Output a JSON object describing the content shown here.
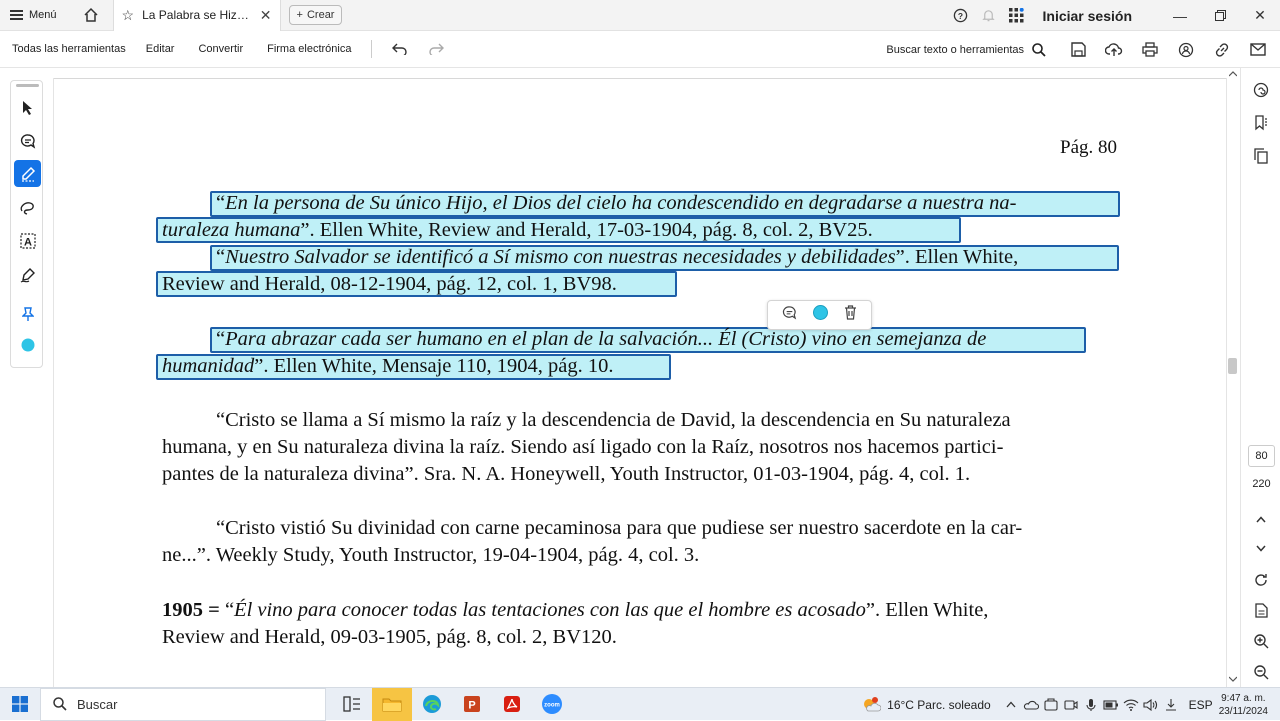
{
  "titlebar": {
    "menu_label": "Menú",
    "tab_title": "La Palabra se Hizo C...",
    "create_label": "Crear",
    "signin_label": "Iniciar sesión"
  },
  "toolbar": {
    "all_tools": "Todas las herramientas",
    "edit": "Editar",
    "convert": "Convertir",
    "esign": "Firma electrónica",
    "search_label": "Buscar texto o herramientas"
  },
  "document": {
    "page_label": "Pág. 80",
    "lines": [
      {
        "pre": "“",
        "it": "En la persona de Su único Hijo, el Dios del cielo ha condescendido en degradarse a nuestra na-",
        "post": ""
      },
      {
        "pre": "",
        "it": "turaleza humana",
        "post": "”. Ellen White, Review and Herald, 17-03-1904, pág. 8, col. 2, BV25."
      },
      {
        "pre": "“",
        "it": "Nuestro Salvador se identificó a Sí mismo con nuestras necesidades y debilidades",
        "post": "”. Ellen White,"
      },
      {
        "pre": "",
        "it": "",
        "post": "Review and Herald, 08-12-1904, pág. 12, col. 1, BV98."
      },
      {
        "pre": "“",
        "it": "Para abrazar cada ser humano en el plan de la salvación... Él (Cristo) vino en semejanza de",
        "post": ""
      },
      {
        "pre": "",
        "it": "humanidad",
        "post": "”. Ellen White, Mensaje 110, 1904, pág. 10."
      },
      {
        "pre": "",
        "it": "",
        "post": "“Cristo se llama a Sí mismo la raíz y la descendencia de David, la descendencia en Su naturaleza"
      },
      {
        "pre": "",
        "it": "",
        "post": "humana, y en Su naturaleza divina la raíz. Siendo así ligado con la Raíz, nosotros nos hacemos partici-"
      },
      {
        "pre": "",
        "it": "",
        "post": "pantes de la naturaleza divina”. Sra. N. A. Honeywell, Youth Instructor, 01-03-1904, pág. 4, col. 1."
      },
      {
        "pre": "",
        "it": "",
        "post": "“Cristo vistió Su divinidad con carne pecaminosa para que pudiese ser nuestro sacerdote en la car-"
      },
      {
        "pre": "",
        "it": "",
        "post": "ne...”. Weekly Study, Youth Instructor, 19-04-1904, pág. 4, col. 3."
      },
      {
        "pre": "",
        "it": "Él vino para conocer todas las tentaciones con las que el hombre es acosado",
        "post": "”. Ellen White,",
        "bold": "1905 = ",
        "pre2": "“"
      },
      {
        "pre": "",
        "it": "",
        "post": "Review and Herald, 09-03-1905, pág. 8, col. 2, BV120."
      }
    ]
  },
  "right_rail": {
    "current_page": "80",
    "total_pages": "220"
  },
  "taskbar": {
    "search_label": "Buscar",
    "weather": "16°C  Parc. soleado",
    "lang": "ESP",
    "time": "9:47 a. m.",
    "date": "23/11/2024"
  },
  "colors": {
    "highlight_fill": "#bff0f7",
    "highlight_border": "#1d5ea8",
    "accent": "#1473e6",
    "highlight_color_dot": "#2ec4e6"
  }
}
